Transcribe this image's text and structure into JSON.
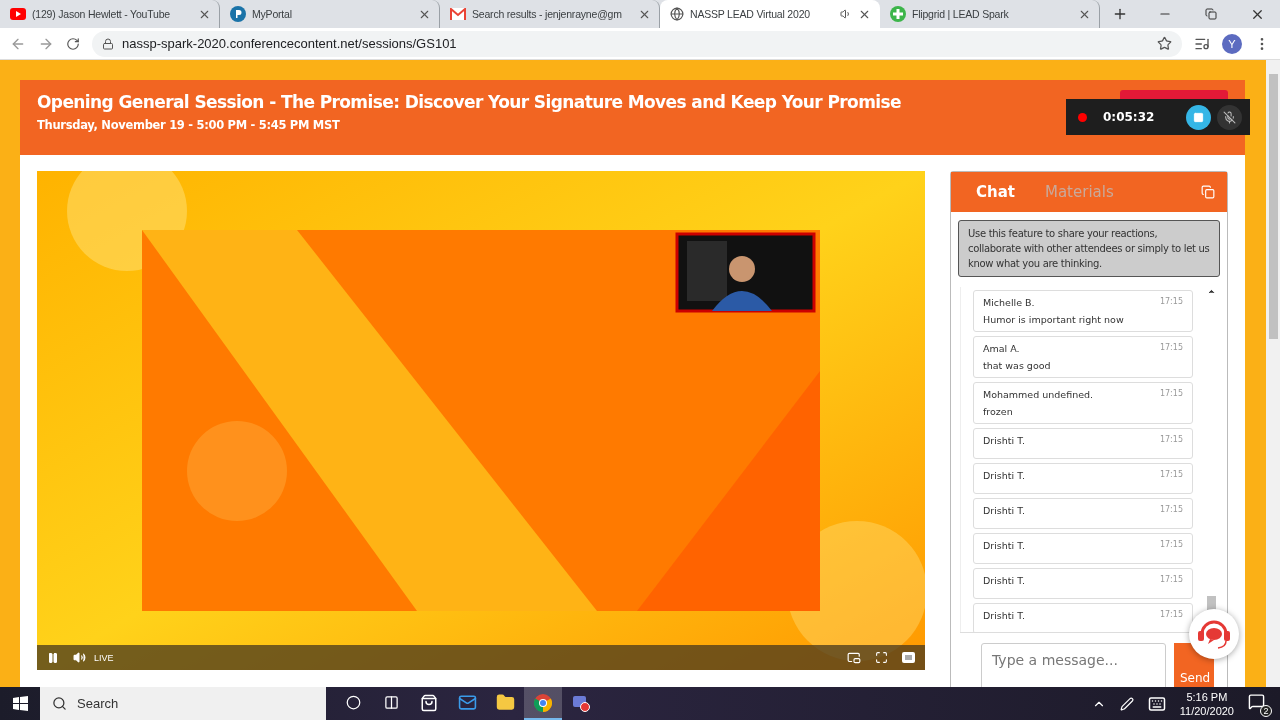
{
  "browser": {
    "tabs": [
      {
        "title": "(129) Jason Hewlett - YouTube",
        "kind": "youtube",
        "selected": false,
        "audio": false
      },
      {
        "title": "MyPortal",
        "kind": "portal",
        "selected": false,
        "audio": false
      },
      {
        "title": "Search results - jenjenrayne@gm",
        "kind": "mail",
        "selected": false,
        "audio": false
      },
      {
        "title": "NASSP LEAD Virtual 2020",
        "kind": "globe",
        "selected": true,
        "audio": true
      },
      {
        "title": "Flipgrid | LEAD Spark",
        "kind": "flipgrid",
        "selected": false,
        "audio": false
      }
    ],
    "url": "nassp-spark-2020.conferencecontent.net/sessions/GS101",
    "profile_initial": "Y"
  },
  "session": {
    "title": "Opening General Session - The Promise: Discover Your Signature Moves and Keep Your Promise",
    "schedule": "Thursday, November 19 - 5:00 PM - 5:45 PM MST"
  },
  "recorder": {
    "elapsed": "0:05:32"
  },
  "video": {
    "kind": "picture",
    "live_label": "LIVE"
  },
  "chat": {
    "tabs": [
      {
        "label": "Chat",
        "selected": true
      },
      {
        "label": "Materials",
        "selected": false
      }
    ],
    "notice": "Use this feature to share your reactions, collaborate with other attendees or simply to let us know what you are thinking.",
    "messages": [
      {
        "author": "Michelle B.",
        "text": "Humor is important right now",
        "time": "17:15"
      },
      {
        "author": "Amal A.",
        "text": "that was good",
        "time": "17:15"
      },
      {
        "author": "Mohammed undefined.",
        "text": "frozen",
        "time": "17:15"
      },
      {
        "author": "Drishti T.",
        "time": "17:15"
      },
      {
        "author": "Drishti T.",
        "time": "17:15"
      },
      {
        "author": "Drishti T.",
        "time": "17:15"
      },
      {
        "author": "Drishti T.",
        "time": "17:15"
      },
      {
        "author": "Drishti T.",
        "time": "17:15"
      },
      {
        "author": "Drishti T.",
        "time": "17:15"
      }
    ],
    "input": {
      "placeholder": "Type a message..."
    },
    "send_label": "Send"
  },
  "taskbar": {
    "search_placeholder": "Search",
    "apps": [
      {
        "kind": "cortana",
        "selected": false
      },
      {
        "kind": "taskview",
        "selected": false
      },
      {
        "kind": "store",
        "selected": false
      },
      {
        "kind": "mail",
        "selected": false
      },
      {
        "kind": "explorer",
        "selected": false
      },
      {
        "kind": "chrome",
        "selected": true
      },
      {
        "kind": "recorder",
        "selected": false
      }
    ],
    "time": "5:16 PM",
    "date": "11/20/2020",
    "notifications": "2"
  }
}
